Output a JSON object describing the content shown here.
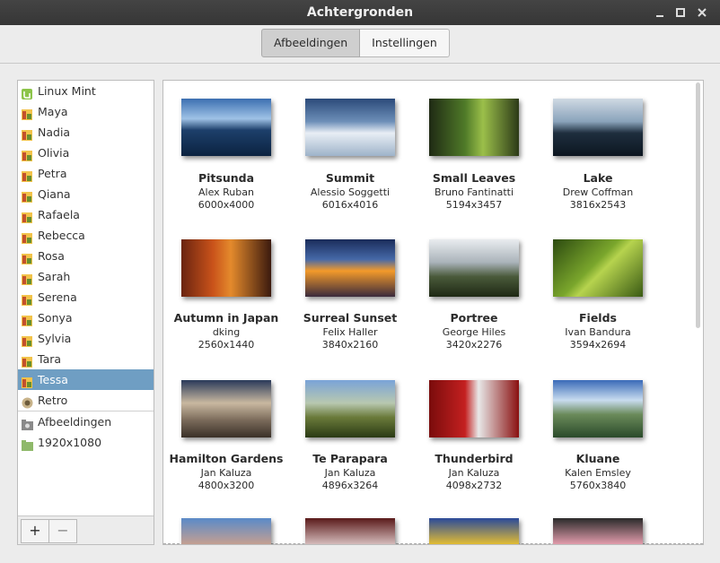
{
  "window": {
    "title": "Achtergronden"
  },
  "tabs": [
    {
      "label": "Afbeeldingen",
      "active": true
    },
    {
      "label": "Instellingen",
      "active": false
    }
  ],
  "sidebar": {
    "items": [
      {
        "label": "Linux Mint",
        "icon": "mint-icon"
      },
      {
        "label": "Maya",
        "icon": "image-folder-icon"
      },
      {
        "label": "Nadia",
        "icon": "image-folder-icon"
      },
      {
        "label": "Olivia",
        "icon": "image-folder-icon"
      },
      {
        "label": "Petra",
        "icon": "image-folder-icon"
      },
      {
        "label": "Qiana",
        "icon": "image-folder-icon"
      },
      {
        "label": "Rafaela",
        "icon": "image-folder-icon"
      },
      {
        "label": "Rebecca",
        "icon": "image-folder-icon"
      },
      {
        "label": "Rosa",
        "icon": "image-folder-icon"
      },
      {
        "label": "Sarah",
        "icon": "image-folder-icon"
      },
      {
        "label": "Serena",
        "icon": "image-folder-icon"
      },
      {
        "label": "Sonya",
        "icon": "image-folder-icon"
      },
      {
        "label": "Sylvia",
        "icon": "image-folder-icon"
      },
      {
        "label": "Tara",
        "icon": "image-folder-icon"
      },
      {
        "label": "Tessa",
        "icon": "image-folder-icon",
        "selected": true
      },
      {
        "label": "Retro",
        "icon": "retro-icon"
      }
    ],
    "folders": [
      {
        "label": "Afbeeldingen",
        "icon": "camera-folder-icon"
      },
      {
        "label": "1920x1080",
        "icon": "folder-icon"
      }
    ],
    "add_label": "+",
    "remove_label": "−"
  },
  "wallpapers": [
    {
      "name": "Pitsunda",
      "author": "Alex Ruban",
      "size": "6000x4000"
    },
    {
      "name": "Summit",
      "author": "Alessio Soggetti",
      "size": "6016x4016"
    },
    {
      "name": "Small Leaves",
      "author": "Bruno Fantinatti",
      "size": "5194x3457"
    },
    {
      "name": "Lake",
      "author": "Drew Coffman",
      "size": "3816x2543"
    },
    {
      "name": "Autumn in Japan",
      "author": "dking",
      "size": "2560x1440"
    },
    {
      "name": "Surreal Sunset",
      "author": "Felix Haller",
      "size": "3840x2160"
    },
    {
      "name": "Portree",
      "author": "George Hiles",
      "size": "3420x2276"
    },
    {
      "name": "Fields",
      "author": "Ivan Bandura",
      "size": "3594x2694"
    },
    {
      "name": "Hamilton Gardens",
      "author": "Jan Kaluza",
      "size": "4800x3200"
    },
    {
      "name": "Te Parapara",
      "author": "Jan Kaluza",
      "size": "4896x3264"
    },
    {
      "name": "Thunderbird",
      "author": "Jan Kaluza",
      "size": "4098x2732"
    },
    {
      "name": "Kluane",
      "author": "Kalen Emsley",
      "size": "5760x3840"
    }
  ]
}
